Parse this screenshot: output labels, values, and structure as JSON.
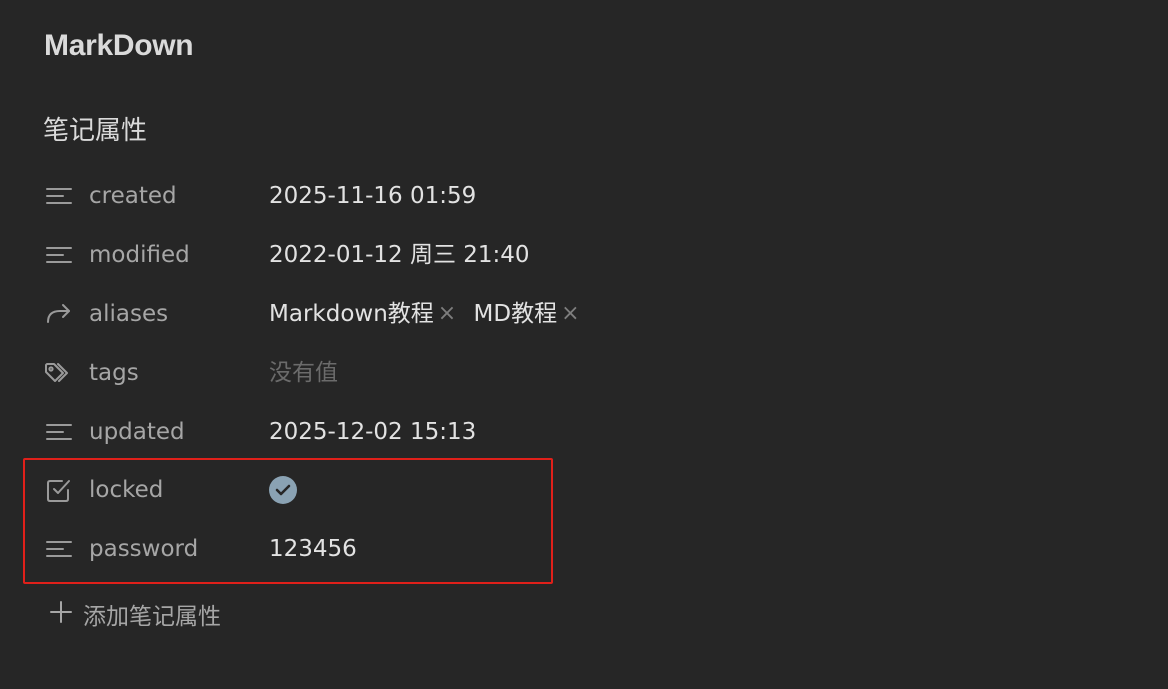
{
  "note": {
    "title": "MarkDown"
  },
  "properties": {
    "heading": "笔记属性",
    "rows": [
      {
        "icon": "text-lines-icon",
        "key": "created",
        "value": "2025-11-16 01:59"
      },
      {
        "icon": "text-lines-icon",
        "key": "modified",
        "value": "2022-01-12 周三 21:40"
      },
      {
        "icon": "link-arrow-icon",
        "key": "aliases",
        "values": [
          "Markdown教程",
          "MD教程"
        ],
        "remove_glyph": "×"
      },
      {
        "icon": "tags-icon",
        "key": "tags",
        "placeholder": "没有值"
      },
      {
        "icon": "text-lines-icon",
        "key": "updated",
        "value": "2025-12-02 15:13"
      },
      {
        "icon": "checkbox-icon",
        "key": "locked",
        "checked": true
      },
      {
        "icon": "text-lines-icon",
        "key": "password",
        "value": "123456"
      }
    ],
    "add_label": "添加笔记属性"
  },
  "colors": {
    "background": "#262626",
    "highlight": "#e0201a",
    "checkbox_fill": "#8aa2b3"
  }
}
